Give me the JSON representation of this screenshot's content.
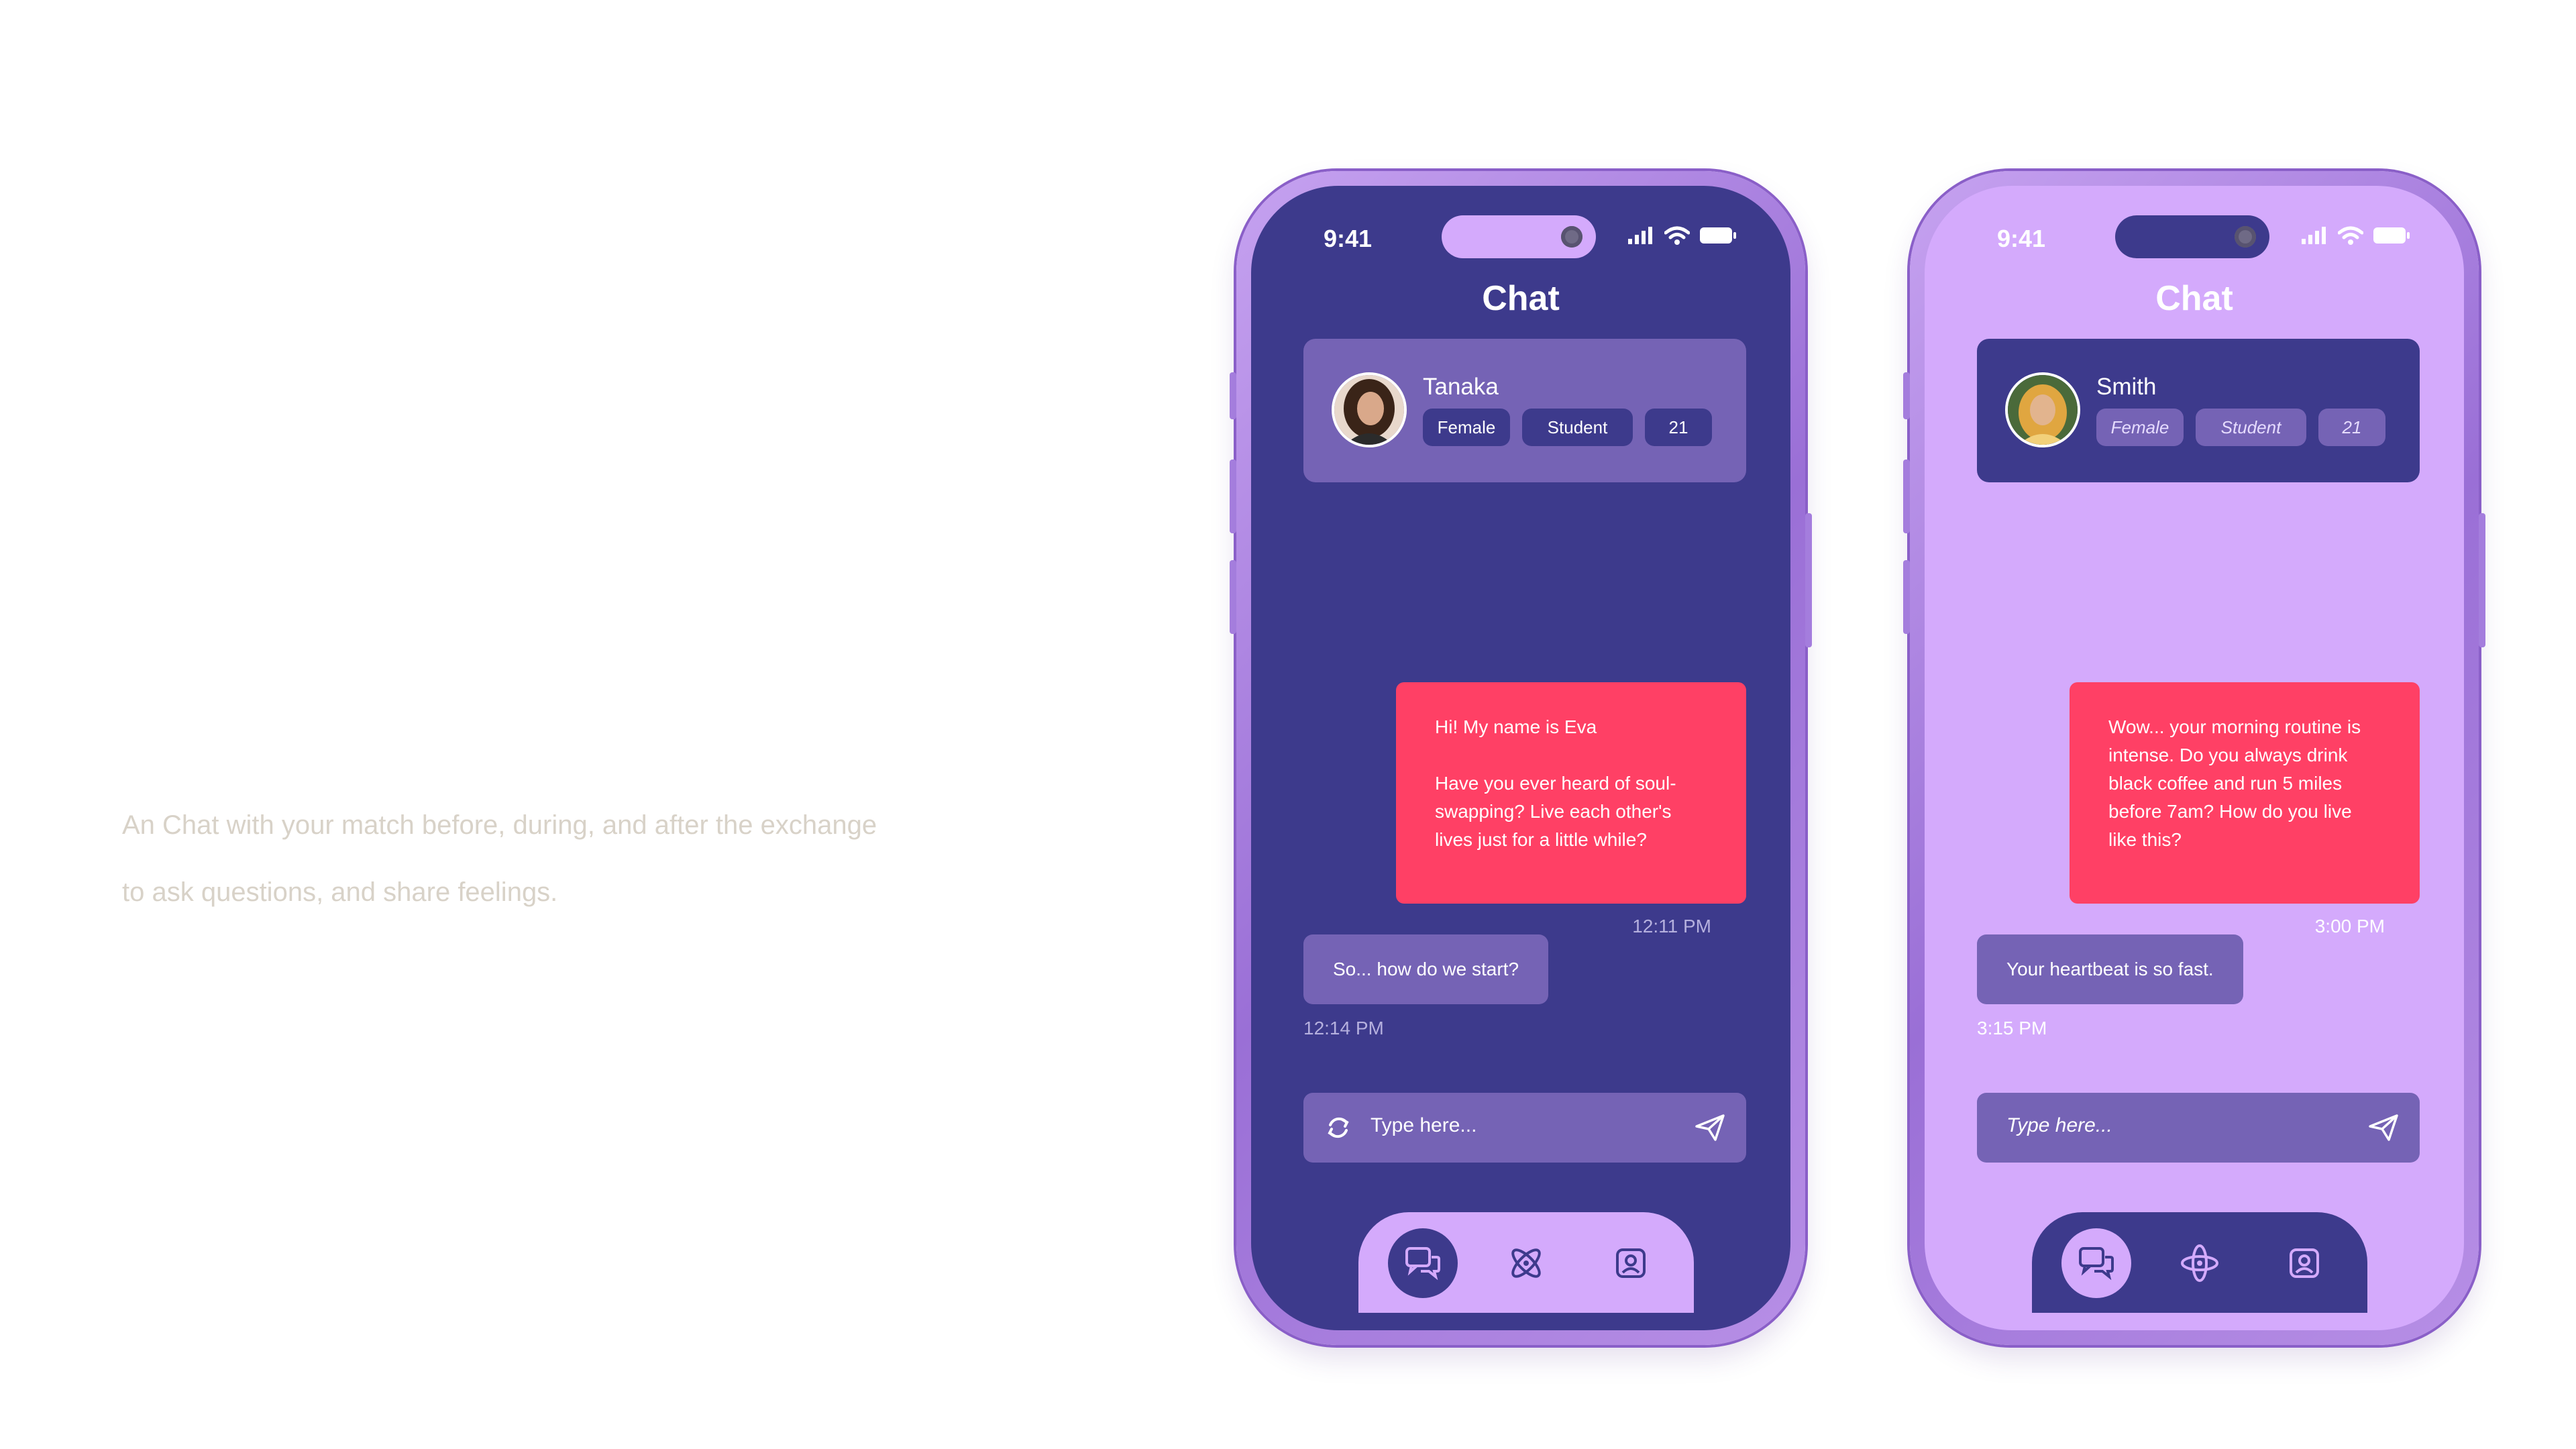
{
  "caption": {
    "line1": "An Chat with your match before, during, and after the exchange",
    "line2": "to ask questions, and share feelings."
  },
  "phones": [
    {
      "theme": "dark",
      "status_time": "9:41",
      "title": "Chat",
      "profile": {
        "name": "Tanaka",
        "tags": [
          "Female",
          "Student",
          "21"
        ]
      },
      "sent_message": {
        "paragraphs": [
          "Hi! My name is Eva",
          "Have you ever heard of soul-swapping? Live each other's lives just for a little while?"
        ],
        "time": "12:11 PM"
      },
      "received_message": {
        "text": "So... how do we start?",
        "time": "12:14 PM"
      },
      "input_placeholder": "Type here...",
      "nav": [
        "chat-icon",
        "atom-icon",
        "profile-icon"
      ]
    },
    {
      "theme": "light",
      "status_time": "9:41",
      "title": "Chat",
      "profile": {
        "name": "Smith",
        "tags": [
          "Female",
          "Student",
          "21"
        ]
      },
      "sent_message": {
        "paragraphs": [
          "Wow... your morning routine is intense. Do you always drink black coffee and run 5 miles before 7am? How do you live like this?"
        ],
        "time": "3:00 PM"
      },
      "received_message": {
        "text": "Your heartbeat is so fast.",
        "time": "3:15 PM"
      },
      "input_placeholder": "Type here...",
      "nav": [
        "chat-icon",
        "atom-icon",
        "profile-icon"
      ]
    }
  ],
  "colors": {
    "dark_screen": "#3d3a8c",
    "light_screen": "#d4aafc",
    "card": "#7563b5",
    "accent": "#ff4065"
  }
}
